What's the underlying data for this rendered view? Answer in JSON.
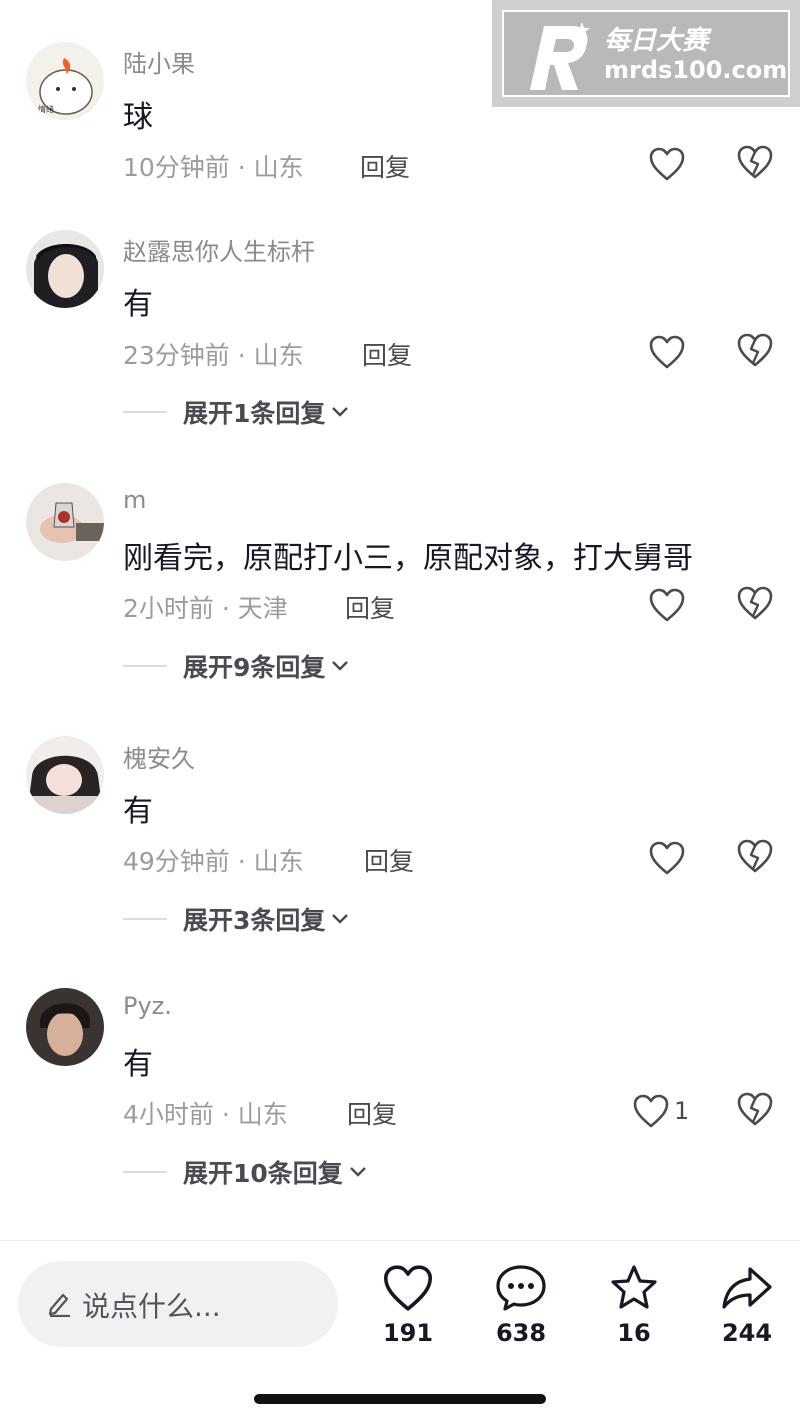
{
  "watermark": {
    "brand": "每日大赛",
    "url": "mrds100.com"
  },
  "comments": [
    {
      "username": "陆小果",
      "text": "球",
      "meta": "10分钟前 · 山东",
      "reply": "回复",
      "likes": "",
      "expand": ""
    },
    {
      "username": "赵露思你人生标杆",
      "text": "有",
      "meta": "23分钟前 · 山东",
      "reply": "回复",
      "likes": "",
      "expand": "展开1条回复"
    },
    {
      "username": "m",
      "text": "刚看完，原配打小三，原配对象，打大舅哥",
      "meta": "2小时前 · 天津",
      "reply": "回复",
      "likes": "",
      "expand": "展开9条回复"
    },
    {
      "username": "槐安久",
      "text": "有",
      "meta": "49分钟前 · 山东",
      "reply": "回复",
      "likes": "",
      "expand": "展开3条回复"
    },
    {
      "username": "Pyz.",
      "text": "有",
      "meta": "4小时前 · 山东",
      "reply": "回复",
      "likes": "1",
      "expand": "展开10条回复"
    }
  ],
  "bottom": {
    "placeholder": "说点什么...",
    "like_count": "191",
    "comment_count": "638",
    "favorite_count": "16",
    "share_count": "244"
  },
  "icons": {
    "like": "heart-outline-icon",
    "dislike": "broken-heart-icon",
    "expand": "chevron-down-icon",
    "comment": "chat-bubble-icon",
    "favorite": "star-outline-icon",
    "share": "share-arrow-icon",
    "edit": "pencil-icon"
  }
}
